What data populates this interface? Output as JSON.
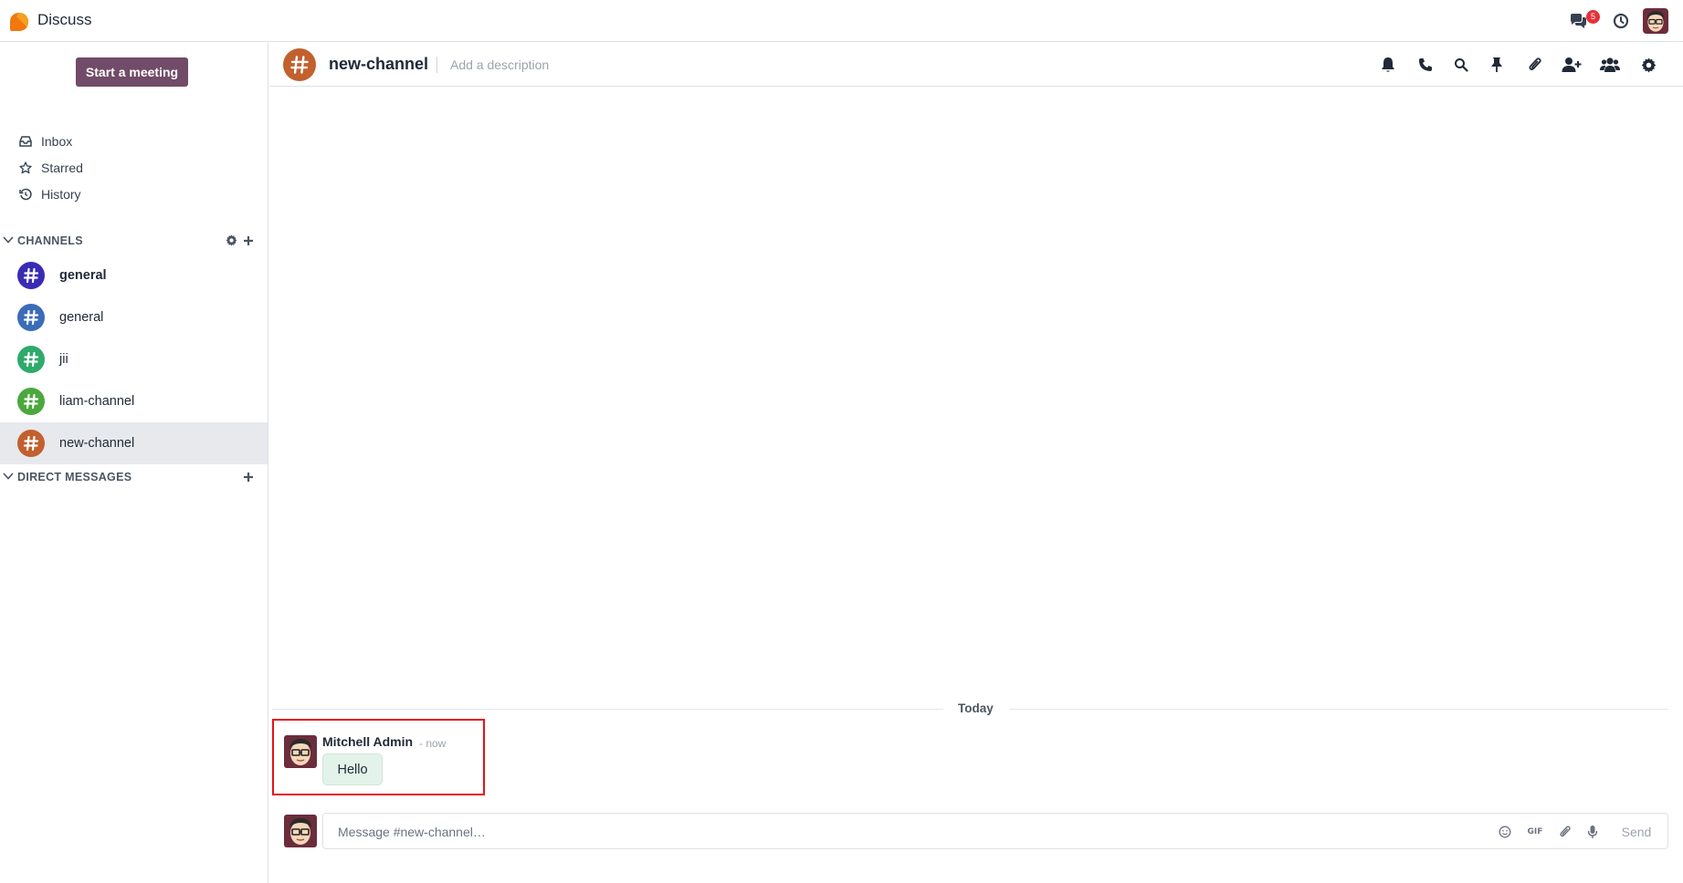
{
  "app": {
    "title": "Discuss",
    "notification_count": "5"
  },
  "sidebar": {
    "meeting_button": "Start a meeting",
    "mailboxes": [
      {
        "label": "Inbox",
        "icon": "inbox-icon"
      },
      {
        "label": "Starred",
        "icon": "star-icon"
      },
      {
        "label": "History",
        "icon": "history-icon"
      }
    ],
    "channels_label": "CHANNELS",
    "channels": [
      {
        "name": "general",
        "color": "#3a2bb5"
      },
      {
        "name": "general",
        "color": "#3b6cb8"
      },
      {
        "name": "jii",
        "color": "#2eaa6b"
      },
      {
        "name": "liam-channel",
        "color": "#4aa83d"
      },
      {
        "name": "new-channel",
        "color": "#c2602e",
        "active": true
      }
    ],
    "dm_label": "DIRECT MESSAGES"
  },
  "thread": {
    "name": "new-channel",
    "description_placeholder": "Add a description",
    "header_icons": [
      "bell-icon",
      "phone-icon",
      "search-icon",
      "pin-icon",
      "paperclip-icon",
      "add-user-icon",
      "members-icon",
      "settings-icon"
    ]
  },
  "messages": {
    "date_divider": "Today",
    "items": [
      {
        "author": "Mitchell Admin",
        "time": "- now",
        "body": "Hello"
      }
    ]
  },
  "composer": {
    "placeholder": "Message #new-channel…",
    "send_label": "Send",
    "gif_label": "GIF"
  },
  "colors": {
    "primary": "#714b67",
    "highlight": "#e3131b",
    "bubble": "#e4f3ea"
  }
}
